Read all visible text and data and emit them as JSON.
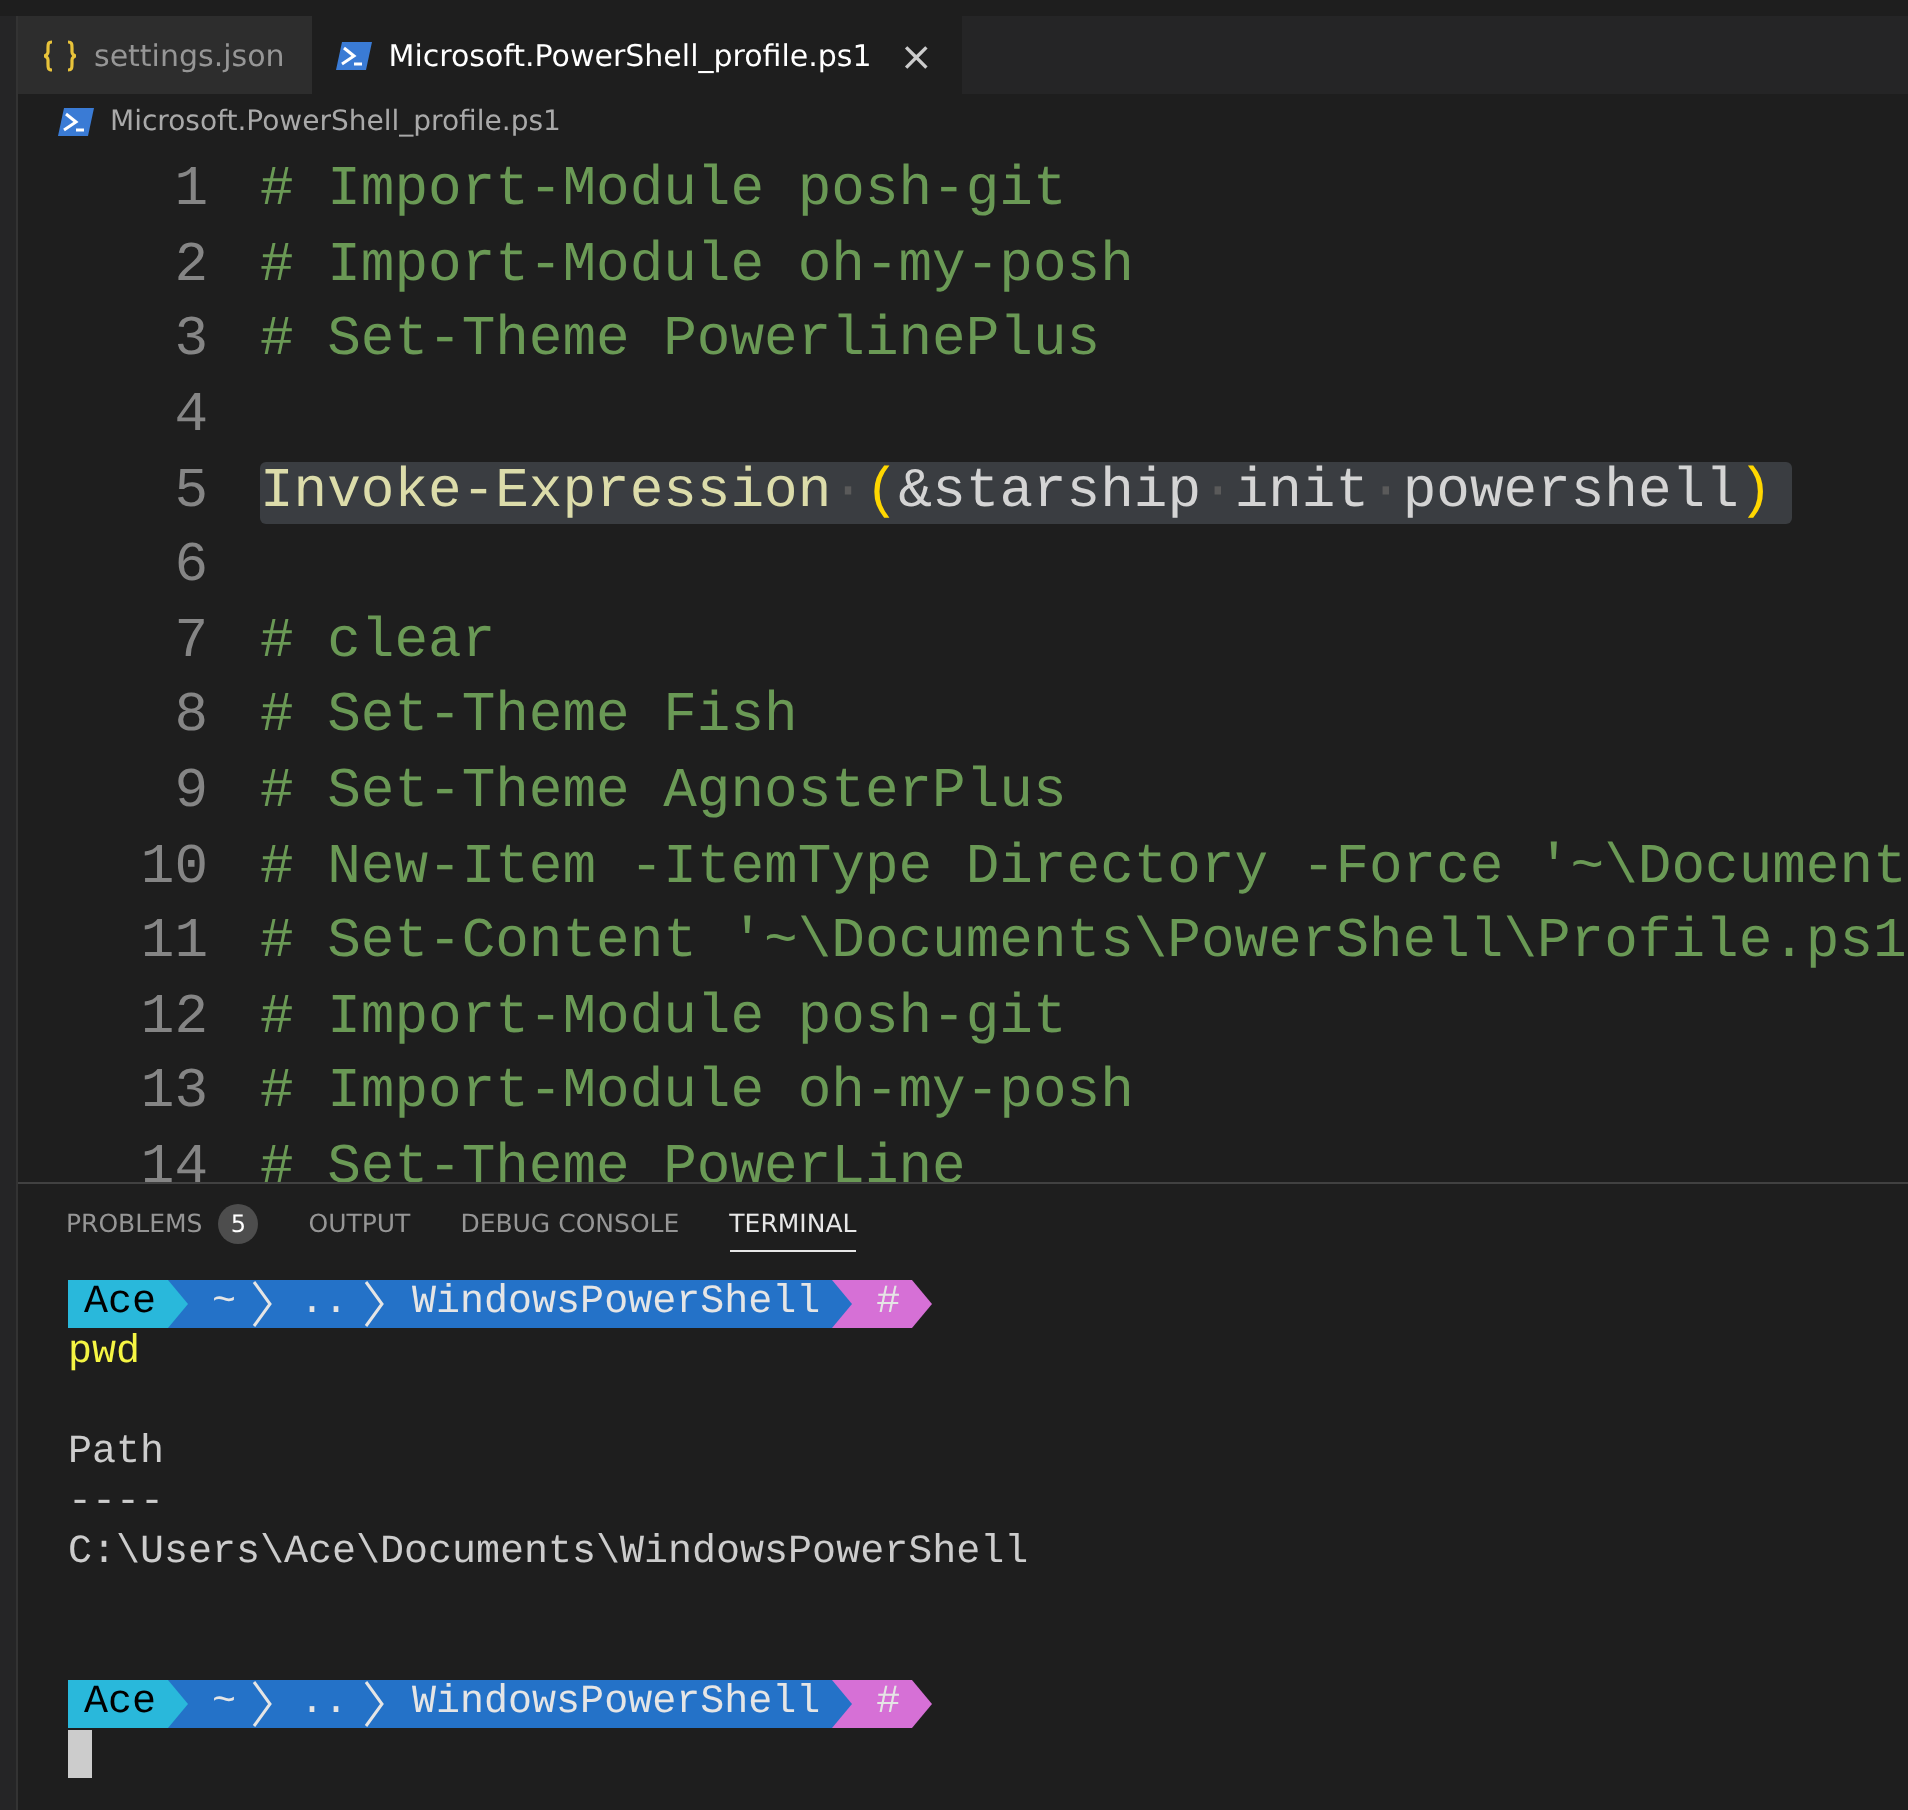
{
  "tabs": [
    {
      "label": "settings.json",
      "kind": "json",
      "selected": false
    },
    {
      "label": "Microsoft.PowerShell_profile.ps1",
      "kind": "powershell",
      "selected": true,
      "close": "×"
    }
  ],
  "breadcrumb": {
    "label": "Microsoft.PowerShell_profile.ps1",
    "kind": "powershell"
  },
  "editor": {
    "lines": [
      {
        "number": "1",
        "tokens": [
          {
            "kind": "comment",
            "text": "# Import-Module posh-git"
          }
        ]
      },
      {
        "number": "2",
        "tokens": [
          {
            "kind": "comment",
            "text": "# Import-Module oh-my-posh"
          }
        ]
      },
      {
        "number": "3",
        "tokens": [
          {
            "kind": "comment",
            "text": "# Set-Theme PowerlinePlus"
          }
        ]
      },
      {
        "number": "4"
      },
      {
        "number": "5",
        "selected": true,
        "tokens": [
          {
            "kind": "function",
            "text": "Invoke-Expression"
          },
          {
            "kind": "whitespace",
            "text": "·"
          },
          {
            "kind": "bracket",
            "text": "("
          },
          {
            "kind": "plain",
            "text": "&starship"
          },
          {
            "kind": "whitespace",
            "text": "·"
          },
          {
            "kind": "plain",
            "text": "init"
          },
          {
            "kind": "whitespace",
            "text": "·"
          },
          {
            "kind": "plain",
            "text": "powershell"
          },
          {
            "kind": "bracket",
            "text": ")"
          }
        ]
      },
      {
        "number": "6"
      },
      {
        "number": "7",
        "tokens": [
          {
            "kind": "comment",
            "text": "# clear"
          }
        ]
      },
      {
        "number": "8",
        "tokens": [
          {
            "kind": "comment",
            "text": "# Set-Theme Fish"
          }
        ]
      },
      {
        "number": "9",
        "tokens": [
          {
            "kind": "comment",
            "text": "# Set-Theme AgnosterPlus"
          }
        ]
      },
      {
        "number": "10",
        "tokens": [
          {
            "kind": "comment",
            "text": "# New-Item -ItemType Directory -Force '~\\Document"
          }
        ]
      },
      {
        "number": "11",
        "tokens": [
          {
            "kind": "comment",
            "text": "# Set-Content '~\\Documents\\PowerShell\\Profile.ps1"
          }
        ]
      },
      {
        "number": "12",
        "tokens": [
          {
            "kind": "comment",
            "text": "# Import-Module posh-git"
          }
        ]
      },
      {
        "number": "13",
        "tokens": [
          {
            "kind": "comment",
            "text": "# Import-Module oh-my-posh"
          }
        ]
      },
      {
        "number": "14",
        "tokens": [
          {
            "kind": "comment",
            "text": "# Set-Theme PowerLine"
          }
        ]
      }
    ]
  },
  "panel": {
    "tabs": [
      {
        "label": "PROBLEMS",
        "badge": "5",
        "selected": false
      },
      {
        "label": "OUTPUT",
        "selected": false
      },
      {
        "label": "DEBUG CONSOLE",
        "selected": false
      },
      {
        "label": "TERMINAL",
        "selected": true
      }
    ],
    "terminal": [
      {
        "kind": "prompt",
        "segments": [
          {
            "text": "Ace",
            "color": "#29b8db"
          },
          {
            "text": "~",
            "color": "#2472c8"
          },
          {
            "text": "..",
            "color": "#2472c8"
          },
          {
            "text": "WindowsPowerShell",
            "color": "#2472c8"
          },
          {
            "text": "#",
            "color": "#d670d6"
          }
        ]
      },
      {
        "kind": "command",
        "text": "pwd"
      },
      {
        "kind": "blank"
      },
      {
        "kind": "output",
        "text": "Path"
      },
      {
        "kind": "output",
        "text": "----"
      },
      {
        "kind": "output",
        "text": "C:\\Users\\Ace\\Documents\\WindowsPowerShell"
      },
      {
        "kind": "blank"
      },
      {
        "kind": "blank"
      },
      {
        "kind": "prompt",
        "segments": [
          {
            "text": "Ace",
            "color": "#29b8db"
          },
          {
            "text": "~",
            "color": "#2472c8"
          },
          {
            "text": "..",
            "color": "#2472c8"
          },
          {
            "text": "WindowsPowerShell",
            "color": "#2472c8"
          },
          {
            "text": "#",
            "color": "#d670d6"
          }
        ]
      },
      {
        "kind": "cursor"
      }
    ]
  }
}
